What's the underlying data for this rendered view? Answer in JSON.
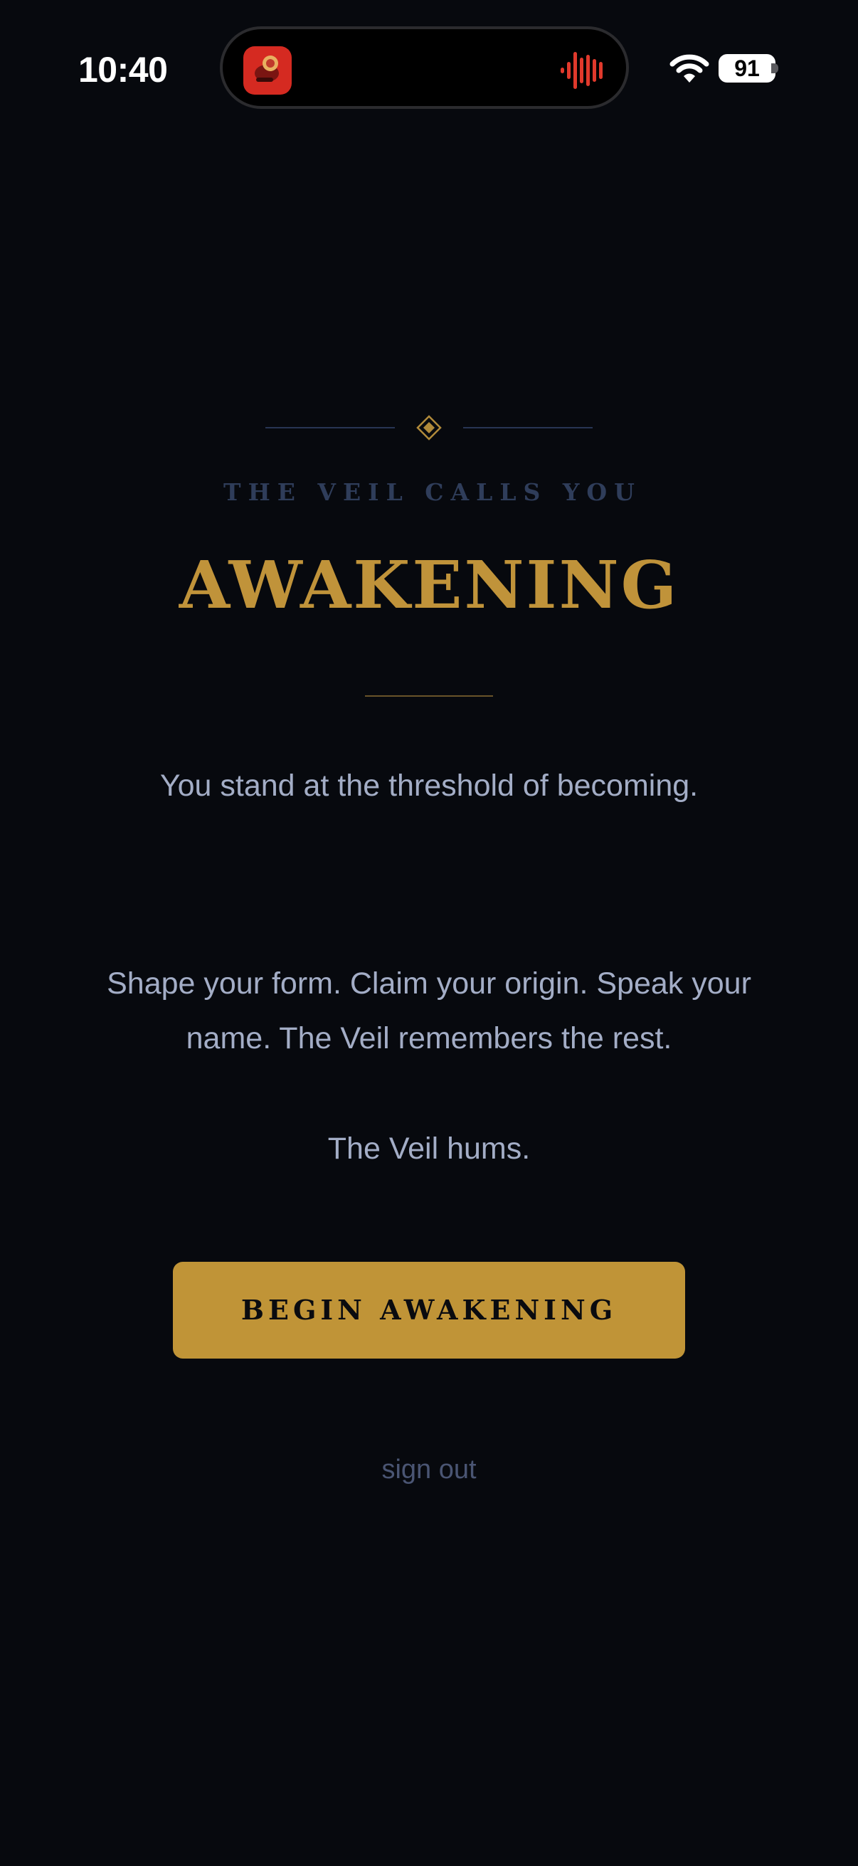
{
  "status_bar": {
    "time": "10:40",
    "battery_level": "91",
    "icons": [
      "app-icon",
      "waveform-icon",
      "wifi-icon",
      "battery-icon"
    ]
  },
  "awakening": {
    "eyebrow": "THE VEIL CALLS YOU",
    "title": "AWAKENING",
    "subtitle": "You stand at the threshold of becoming.",
    "description": "Shape your form. Claim your origin. Speak your name. The Veil remembers the rest.",
    "hum": "The Veil hums.",
    "begin_label": "BEGIN AWAKENING",
    "sign_out_label": "sign out"
  },
  "colors": {
    "background": "#07090e",
    "gold": "#c0933a",
    "text": "#a3adc6",
    "muted_navy": "#2f3d5a",
    "recording_red": "#e0392c"
  }
}
